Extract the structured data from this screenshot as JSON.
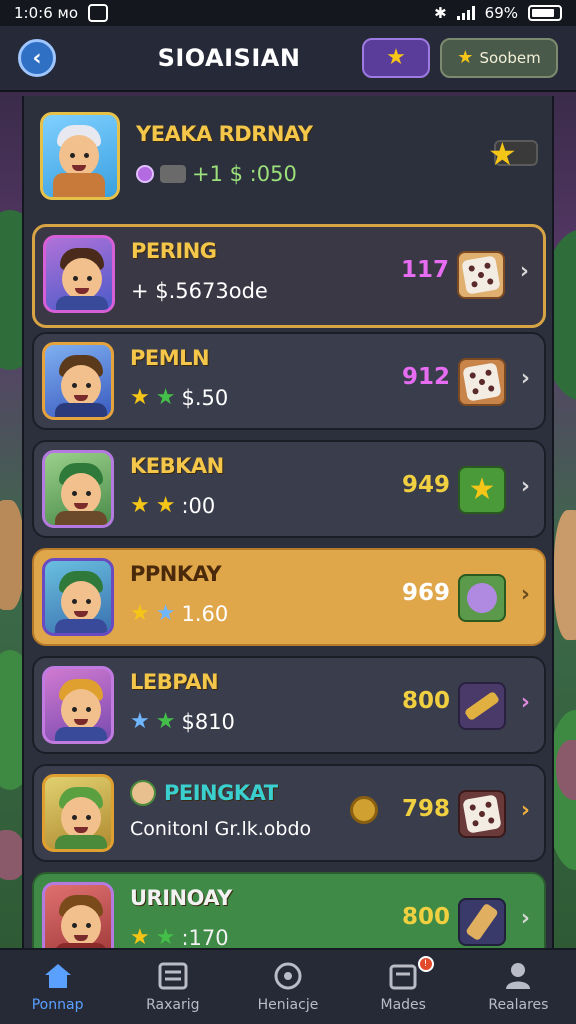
{
  "status": {
    "time": "1:0:6 мо",
    "battery": "69%"
  },
  "header": {
    "title": "SIOAISIAN",
    "redeem_label": "Soobem"
  },
  "rows": [
    {
      "name": "YEAKA RDRNAY",
      "value": "+1 $ :050",
      "count": ""
    },
    {
      "name": "PERING",
      "value": "+ $.5673ode",
      "count": "117"
    },
    {
      "name": "PEMLN",
      "value": "$.50",
      "count": "912"
    },
    {
      "name": "KEBKAN",
      "value": ":00",
      "count": "949"
    },
    {
      "name": "PPNKAY",
      "value": "1.60",
      "count": "969"
    },
    {
      "name": "LEBPAN",
      "value": "$810",
      "count": "800"
    },
    {
      "name": "PEINGKAT",
      "value": "Conitonl Gr.lk.obdo",
      "count": "798"
    },
    {
      "name": "URINOAY",
      "value": ":170",
      "count": "800"
    }
  ],
  "nav": [
    {
      "label": "Ponnap",
      "icon": "home-icon"
    },
    {
      "label": "Raxarig",
      "icon": "list-icon"
    },
    {
      "label": "Heniacje",
      "icon": "circle-icon"
    },
    {
      "label": "Mades",
      "icon": "inbox-icon"
    },
    {
      "label": "Realares",
      "icon": "profile-icon"
    }
  ],
  "colors": {
    "accent": "#5aa0ff",
    "gold": "#f4c64a",
    "highlight": "#e0a64a",
    "green_row": "#3e8a46"
  }
}
